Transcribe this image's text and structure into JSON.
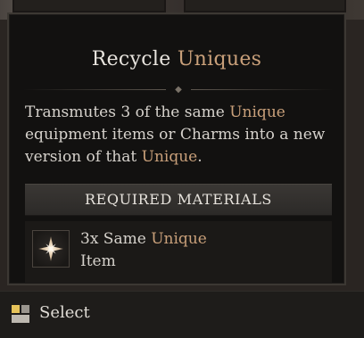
{
  "tooltip": {
    "title_prefix": "Recycle",
    "title_accent": "Uniques",
    "description": {
      "part1": "Transmutes 3 of the same",
      "accent1": "Unique",
      "part2": "equipment items or Charms into a new version of that",
      "accent2": "Unique",
      "part3": "."
    },
    "required_header": "REQUIRED MATERIALS",
    "material": {
      "icon": "unique-star-icon",
      "prefix": "3x Same",
      "accent": "Unique",
      "suffix": "Item"
    }
  },
  "footer": {
    "key_icon": "mouse-button-icon",
    "action_label": "Select"
  },
  "colors": {
    "accent_unique": "#c9a07a",
    "text": "#d6d2cc",
    "panel_bg": "#121110"
  }
}
